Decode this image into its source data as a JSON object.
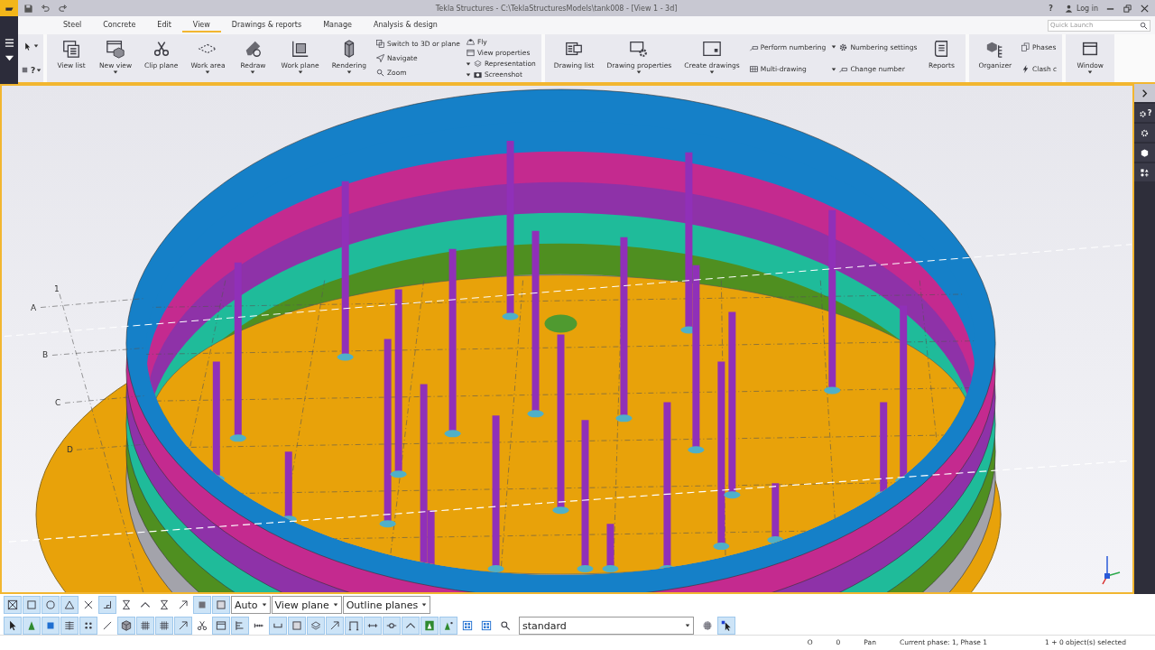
{
  "title_bar": {
    "title": "Tekla Structures - C:\\TeklaStructuresModels\\tank008 - [View 1 - 3d]",
    "help": "?",
    "login": "Log in"
  },
  "menu_tabs": [
    {
      "label": "Steel",
      "selected": false
    },
    {
      "label": "Concrete",
      "selected": false
    },
    {
      "label": "Edit",
      "selected": false
    },
    {
      "label": "View",
      "selected": true
    },
    {
      "label": "Drawings & reports",
      "selected": false
    },
    {
      "label": "Manage",
      "selected": false
    },
    {
      "label": "Analysis & design",
      "selected": false
    }
  ],
  "quick_launch": {
    "placeholder": "Quick Launch"
  },
  "select_tools": {
    "help_mark": "?"
  },
  "ribbon": {
    "groups": [
      {
        "items": [
          {
            "kind": "large",
            "label": "View list",
            "dropdown": false
          },
          {
            "kind": "large",
            "label": "New view",
            "dropdown": true
          },
          {
            "kind": "large",
            "label": "Clip plane",
            "dropdown": false
          },
          {
            "kind": "large",
            "label": "Work area",
            "dropdown": true
          },
          {
            "kind": "large",
            "label": "Redraw",
            "dropdown": true
          },
          {
            "kind": "large",
            "label": "Work plane",
            "dropdown": true
          },
          {
            "kind": "large",
            "label": "Rendering",
            "dropdown": true
          },
          {
            "kind": "stack",
            "items": [
              {
                "label": "Switch to 3D or plane",
                "dropdown": false
              },
              {
                "label": "Navigate",
                "dropdown": false
              },
              {
                "label": "Zoom",
                "dropdown": false
              }
            ]
          },
          {
            "kind": "stack",
            "items": [
              {
                "label": "Fly",
                "dropdown": false
              },
              {
                "label": "View properties",
                "dropdown": false
              },
              {
                "label": "Representation",
                "dropdown": true
              },
              {
                "label": "Screenshot",
                "dropdown": true
              }
            ]
          }
        ]
      },
      {
        "items": [
          {
            "kind": "large",
            "label": "Drawing list",
            "dropdown": false
          },
          {
            "kind": "large",
            "label": "Drawing properties",
            "dropdown": true
          },
          {
            "kind": "large",
            "label": "Create drawings",
            "dropdown": true
          },
          {
            "kind": "stack",
            "items": [
              {
                "label": "Perform numbering",
                "dropdown": false
              },
              {
                "label": "Multi-drawing",
                "dropdown": false
              }
            ]
          },
          {
            "kind": "stack",
            "items": [
              {
                "label": "Numbering settings",
                "dropdown": true
              },
              {
                "label": "Change number",
                "dropdown": true
              }
            ]
          },
          {
            "kind": "large",
            "label": "Reports",
            "dropdown": false
          }
        ]
      },
      {
        "items": [
          {
            "kind": "large",
            "label": "Organizer",
            "dropdown": false
          },
          {
            "kind": "stack",
            "items": [
              {
                "label": "Phases",
                "dropdown": false
              },
              {
                "label": "Clash c",
                "dropdown": false
              }
            ]
          }
        ]
      },
      {
        "items": [
          {
            "kind": "large",
            "label": "Window",
            "dropdown": true
          }
        ]
      }
    ]
  },
  "side_panel": {
    "help_mark": "?"
  },
  "viewport": {
    "grid_labels": [
      "1",
      "A",
      "B",
      "C",
      "D"
    ]
  },
  "toolbar_rows": [
    {
      "items": [
        {
          "kind": "button",
          "on": true
        },
        {
          "kind": "button",
          "on": true
        },
        {
          "kind": "button",
          "on": true
        },
        {
          "kind": "button",
          "on": true
        },
        {
          "kind": "button",
          "on": false
        },
        {
          "kind": "button",
          "on": true
        },
        {
          "kind": "button",
          "on": false
        },
        {
          "kind": "button",
          "on": false
        },
        {
          "kind": "button",
          "on": false
        },
        {
          "kind": "button",
          "on": false
        },
        {
          "kind": "button",
          "on": true
        },
        {
          "kind": "button",
          "on": true
        },
        {
          "kind": "select",
          "value": "Auto"
        },
        {
          "kind": "select",
          "value": "View plane"
        },
        {
          "kind": "select",
          "value": "Outline planes"
        }
      ]
    },
    {
      "items": [
        {
          "kind": "button",
          "on": true
        },
        {
          "kind": "button",
          "on": true
        },
        {
          "kind": "button",
          "on": true
        },
        {
          "kind": "button",
          "on": true
        },
        {
          "kind": "button",
          "on": true
        },
        {
          "kind": "button",
          "on": false
        },
        {
          "kind": "button",
          "on": true
        },
        {
          "kind": "button",
          "on": true
        },
        {
          "kind": "button",
          "on": true
        },
        {
          "kind": "button",
          "on": true
        },
        {
          "kind": "button",
          "on": false
        },
        {
          "kind": "button",
          "on": true
        },
        {
          "kind": "button",
          "on": true
        },
        {
          "kind": "button",
          "on": false
        },
        {
          "kind": "button",
          "on": true
        },
        {
          "kind": "button",
          "on": true
        },
        {
          "kind": "button",
          "on": true
        },
        {
          "kind": "button",
          "on": true
        },
        {
          "kind": "button",
          "on": true
        },
        {
          "kind": "button",
          "on": true
        },
        {
          "kind": "button",
          "on": true
        },
        {
          "kind": "button",
          "on": true
        },
        {
          "kind": "button",
          "on": true
        },
        {
          "kind": "button",
          "on": true
        },
        {
          "kind": "button",
          "on": false
        },
        {
          "kind": "button",
          "on": false
        },
        {
          "kind": "button",
          "on": false
        },
        {
          "kind": "select",
          "value": "standard"
        },
        {
          "kind": "button",
          "on": false
        },
        {
          "kind": "button",
          "on": true
        }
      ]
    }
  ],
  "status_bar": {
    "items": [
      "O",
      "0",
      "Pan",
      "Current phase: 1, Phase 1",
      "1 + 0 object(s) selected"
    ]
  }
}
